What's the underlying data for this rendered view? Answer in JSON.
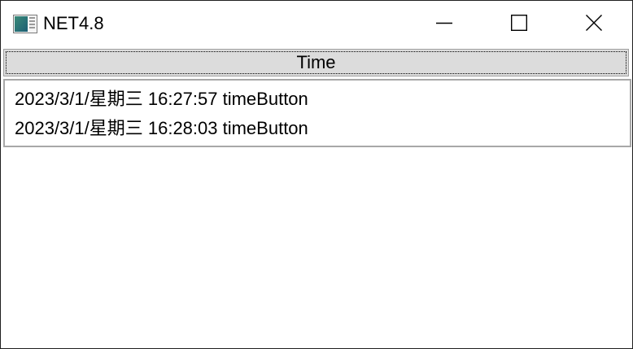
{
  "window": {
    "title": "NET4.8",
    "icon": "app-window-icon",
    "controls": {
      "minimize_icon": "minimize-icon",
      "maximize_icon": "maximize-icon",
      "close_icon": "close-icon"
    }
  },
  "toolbar": {
    "time_button_label": "Time"
  },
  "log": {
    "items": [
      "2023/3/1/星期三 16:27:57 timeButton",
      "2023/3/1/星期三 16:28:03 timeButton"
    ]
  },
  "colors": {
    "button_face": "#dcdcdc",
    "list_border": "#a8a8a8",
    "window_border": "#1f1f1f"
  }
}
